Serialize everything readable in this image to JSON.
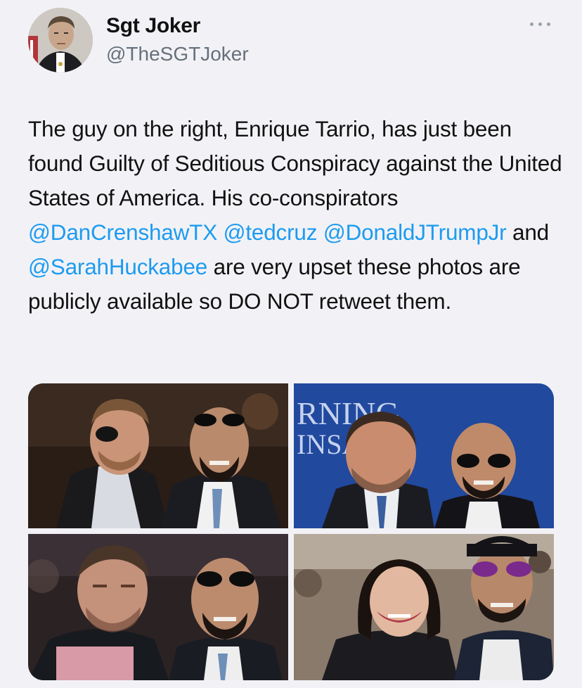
{
  "author": {
    "name": "Sgt Joker",
    "handle": "@TheSGTJoker"
  },
  "tweet": {
    "text_1": "The guy on the right, Enrique Tarrio, has just been found Guilty of Seditious Conspiracy against the United States of America. His co-conspirators ",
    "mention_1": "@DanCrenshawTX",
    "mention_2": "@tedcruz",
    "mention_3": "@DonaldJTrumpJr",
    "text_and": " and ",
    "mention_4": "@SarahHuckabee",
    "text_2": " are very upset these photos are publicly available so DO NOT retweet them."
  },
  "media": {
    "photo_2_backdrop_text_1": "RNING",
    "photo_2_backdrop_text_2": "INSA"
  },
  "colors": {
    "background": "#f2f2f6",
    "mention": "#1d9bf0",
    "secondary_text": "#66707a"
  },
  "icons": [
    "more-options-icon"
  ]
}
